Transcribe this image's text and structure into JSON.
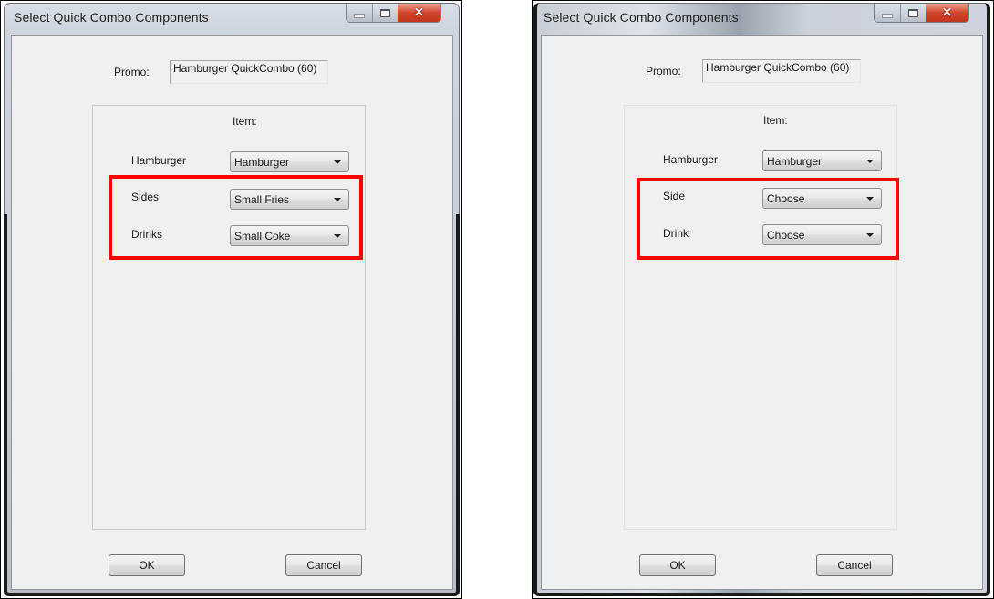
{
  "panels": {
    "left": {
      "window": {
        "title": "Select Quick Combo Components",
        "controls": {
          "minimize": "minimize",
          "maximize": "maximize",
          "close": "✕"
        }
      },
      "promo": {
        "label": "Promo:",
        "value": "Hamburger QuickCombo (60)"
      },
      "item_header": "Item:",
      "rows": [
        {
          "label": "Hamburger",
          "selected": "Hamburger"
        },
        {
          "label": "Sides",
          "selected": "Small Fries"
        },
        {
          "label": "Drinks",
          "selected": "Small Coke"
        }
      ],
      "buttons": {
        "ok": "OK",
        "cancel": "Cancel"
      }
    },
    "right": {
      "window": {
        "title": "Select Quick Combo Components",
        "controls": {
          "minimize": "minimize",
          "maximize": "maximize",
          "close": "✕"
        }
      },
      "promo": {
        "label": "Promo:",
        "value": "Hamburger QuickCombo (60)"
      },
      "item_header": "Item:",
      "rows": [
        {
          "label": "Hamburger",
          "selected": "Hamburger"
        },
        {
          "label": "Side",
          "selected": "Choose"
        },
        {
          "label": "Drink",
          "selected": "Choose"
        }
      ],
      "buttons": {
        "ok": "OK",
        "cancel": "Cancel"
      }
    }
  },
  "colors": {
    "highlight": "#ff0000",
    "close_button": "#c8381f",
    "dialog_background": "#f0f0f0"
  }
}
